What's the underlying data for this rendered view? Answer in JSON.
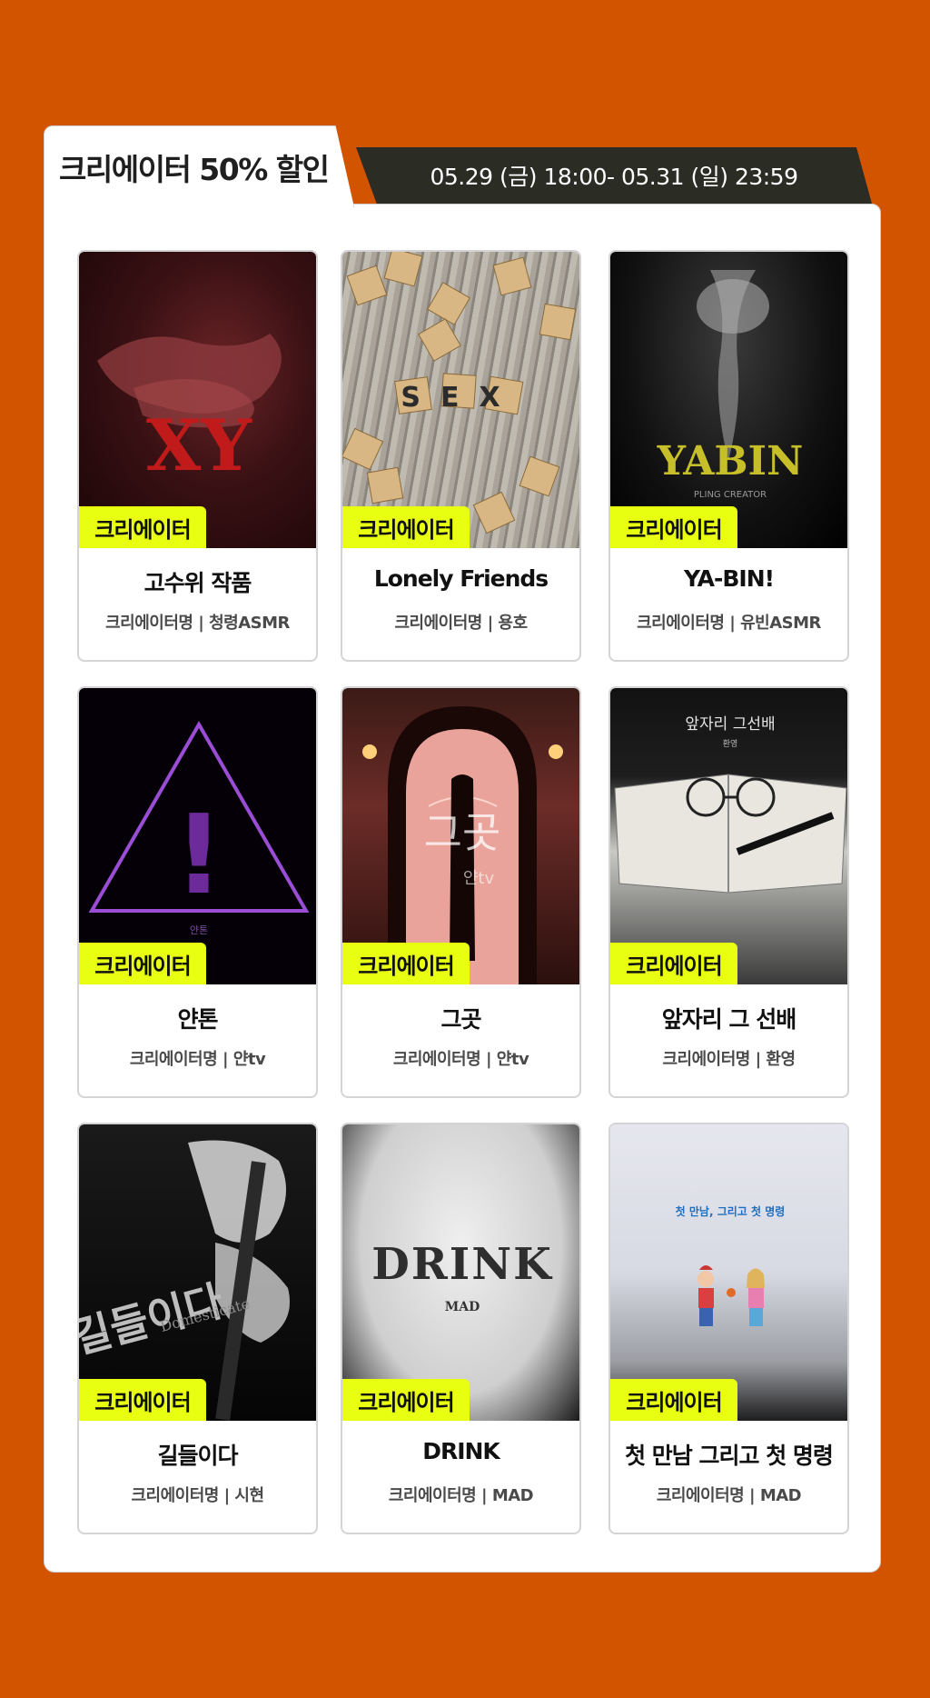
{
  "header": {
    "title": "크리에이터 50% 할인",
    "period": "05.29 (금) 18:00- 05.31 (일) 23:59"
  },
  "badge_label": "크리에이터",
  "cards": [
    {
      "title": "고수위 작품",
      "subtitle": "크리에이터명 | 청령ASMR",
      "art_text": "XY",
      "icon": "xy-cover-art"
    },
    {
      "title": "Lonely Friends",
      "subtitle": "크리에이터명 | 용호",
      "art_text": "SEX",
      "icon": "scrabble-tiles-cover-art"
    },
    {
      "title": "YA-BIN!",
      "subtitle": "크리에이터명 | 유빈ASMR",
      "art_text": "YABIN",
      "art_subtext": "PLING CREATOR",
      "icon": "yabin-cover-art"
    },
    {
      "title": "얀톤",
      "subtitle": "크리에이터명 | 얀tv",
      "art_text": "!",
      "art_subtext": "얀톤",
      "icon": "warning-triangle-cover-art"
    },
    {
      "title": "그곳",
      "subtitle": "크리에이터명 | 얀tv",
      "art_text": "그곳",
      "art_subtext": "얀tv",
      "icon": "doorway-cover-art"
    },
    {
      "title": "앞자리 그 선배",
      "subtitle": "크리에이터명 | 환영",
      "art_text": "앞자리 그선배",
      "art_subtext": "환영",
      "icon": "notebook-glasses-cover-art"
    },
    {
      "title": "길들이다",
      "subtitle": "크리에이터명 | 시현",
      "art_text": "길들이다",
      "art_subtext": "Domesticate",
      "icon": "belt-hands-cover-art"
    },
    {
      "title": "DRINK",
      "subtitle": "크리에이터명 | MAD",
      "art_text": "DRINK",
      "art_subtext": "MAD",
      "icon": "drink-cover-art"
    },
    {
      "title": "첫 만남 그리고 첫 명령",
      "subtitle": "크리에이터명 | MAD",
      "art_text": "첫 만남, 그리고 첫 명령",
      "icon": "toy-figures-cover-art"
    }
  ],
  "colors": {
    "background": "#d35400",
    "badge": "#e8ff12",
    "period_bar": "#2b2c24"
  }
}
